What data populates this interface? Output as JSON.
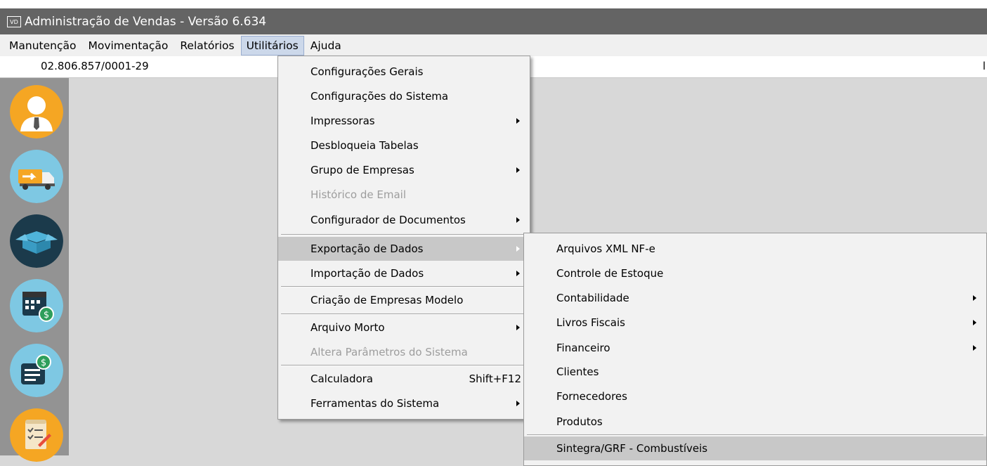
{
  "window": {
    "icon_text": "VD",
    "title": "Administração de Vendas - Versão 6.634"
  },
  "menubar": [
    {
      "label": "Manutenção"
    },
    {
      "label": "Movimentação"
    },
    {
      "label": "Relatórios"
    },
    {
      "label": "Utilitários"
    },
    {
      "label": "Ajuda"
    }
  ],
  "cnpj_bar": {
    "cnpj": "02.806.857/0001-29",
    "right_text": "l"
  },
  "sidebar": {
    "buttons": [
      "user-icon",
      "delivery-truck-icon",
      "box-icon",
      "calendar-money-icon",
      "billing-document-icon",
      "checklist-icon"
    ]
  },
  "utilitarios_menu": {
    "items": [
      {
        "label": "Configurações Gerais"
      },
      {
        "label": "Configurações do Sistema"
      },
      {
        "label": "Impressoras"
      },
      {
        "label": "Desbloqueia Tabelas"
      },
      {
        "label": "Grupo de Empresas"
      },
      {
        "label": "Histórico de Email"
      },
      {
        "label": "Configurador de Documentos"
      },
      {
        "label": "Exportação de Dados"
      },
      {
        "label": "Importação de Dados"
      },
      {
        "label": "Criação de Empresas Modelo"
      },
      {
        "label": "Arquivo Morto"
      },
      {
        "label": "Altera Parâmetros do Sistema"
      },
      {
        "label": "Calculadora",
        "shortcut": "Shift+F12"
      },
      {
        "label": "Ferramentas do Sistema"
      }
    ]
  },
  "exportacao_submenu": {
    "items": [
      {
        "label": "Arquivos XML NF-e"
      },
      {
        "label": "Controle de Estoque"
      },
      {
        "label": "Contabilidade"
      },
      {
        "label": "Livros Fiscais"
      },
      {
        "label": "Financeiro"
      },
      {
        "label": "Clientes"
      },
      {
        "label": "Fornecedores"
      },
      {
        "label": "Produtos"
      },
      {
        "label": "Sintegra/GRF - Combustíveis"
      }
    ]
  },
  "colors": {
    "titlebar": "#646464",
    "menu_highlight": "#c8c8c8",
    "active_top_menu": "#ccd8ea",
    "sidebar": "#939393"
  }
}
